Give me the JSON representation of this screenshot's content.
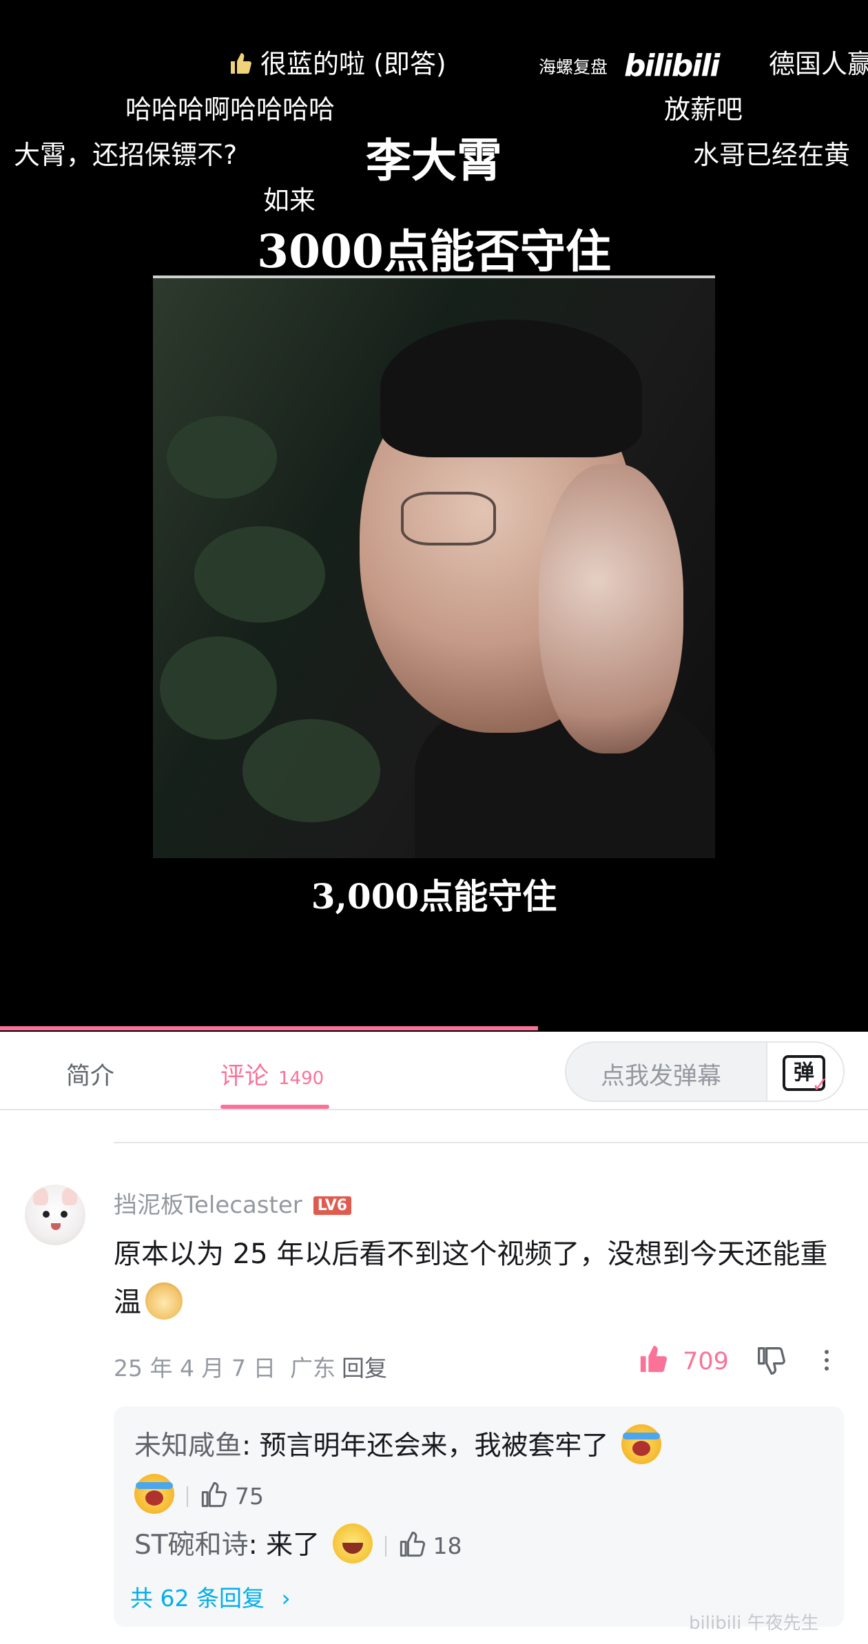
{
  "video": {
    "danmaku": [
      "很蓝的啦 (即答)",
      "哈哈哈啊哈哈哈哈",
      "大霄，还招保镖不?",
      "如来",
      "德国人赢",
      "放薪吧",
      "水哥已经在黄"
    ],
    "watermark": "海螺复盘",
    "bili_logo": "bilibili",
    "name_title": "李大霄",
    "headline": "3000点能否守住",
    "subtitle": "3,000点能守住",
    "progress": 0.62
  },
  "tabs": {
    "intro": "简介",
    "comments": "评论",
    "comments_count": "1490",
    "danmaku_placeholder": "点我发弹幕",
    "danmaku_btn": "弹"
  },
  "comment": {
    "username": "挡泥板Telecaster",
    "level": "LV6",
    "text": "原本以为 25 年以后看不到这个视频了，没想到今天还能重温",
    "date": "25 年 4 月 7 日",
    "location": "广东",
    "reply_label": "回复",
    "likes": "709"
  },
  "replies": {
    "items": [
      {
        "name": "未知咸鱼",
        "text": ": 预言明年还会来，我被套牢了",
        "likes": "75"
      },
      {
        "name": "ST碗和诗",
        "text": ": 来了",
        "likes": "18"
      }
    ],
    "total": "共 62 条回复",
    "total_arrow": "›"
  },
  "corner_watermark": "bilibili 午夜先生",
  "colors": {
    "accent": "#fb7299",
    "link": "#00aeec",
    "bg": "#ffffff",
    "video_bg": "#000000"
  }
}
